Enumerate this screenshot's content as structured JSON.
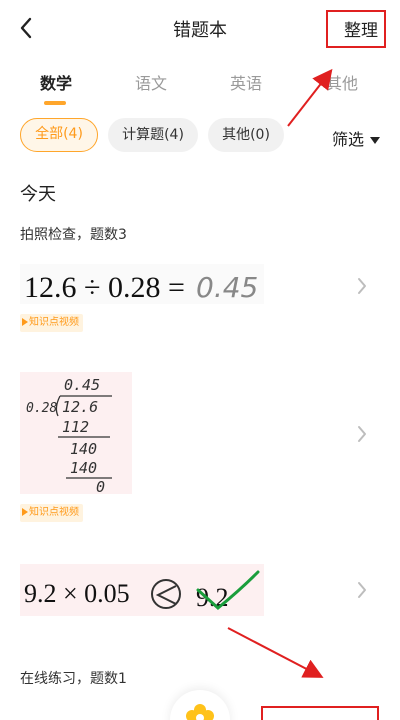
{
  "nav": {
    "title": "错题本",
    "organize_label": "整理"
  },
  "tabs": [
    {
      "label": "数学",
      "active": true
    },
    {
      "label": "语文",
      "active": false
    },
    {
      "label": "英语",
      "active": false
    },
    {
      "label": "其他",
      "active": false
    }
  ],
  "filters": {
    "chips": [
      {
        "label": "全部(4)",
        "active": true
      },
      {
        "label": "计算题(4)",
        "active": false
      },
      {
        "label": "其他(0)",
        "active": false
      }
    ],
    "screen_label": "筛选"
  },
  "section": {
    "date": "今天"
  },
  "photo_group": {
    "label": "拍照检查，题数3",
    "items": [
      {
        "kind": "printed-equation",
        "expression": "12.6 ÷ 0.28 =",
        "handwritten_answer": "0.45",
        "video_tag": "知识点视频"
      },
      {
        "kind": "long-division",
        "lines": [
          "0.45",
          "0.28",
          "12.6",
          "112",
          "140",
          "140",
          "0"
        ],
        "video_tag": "知识点视频"
      },
      {
        "kind": "comparison",
        "left": "9.2 × 0.05",
        "right": "9.2"
      }
    ]
  },
  "online_group": {
    "label": "在线练习，题数1"
  },
  "colors": {
    "accent": "#ffa62b",
    "annotation": "#e02020",
    "correct_mark": "#1a9e3c"
  }
}
